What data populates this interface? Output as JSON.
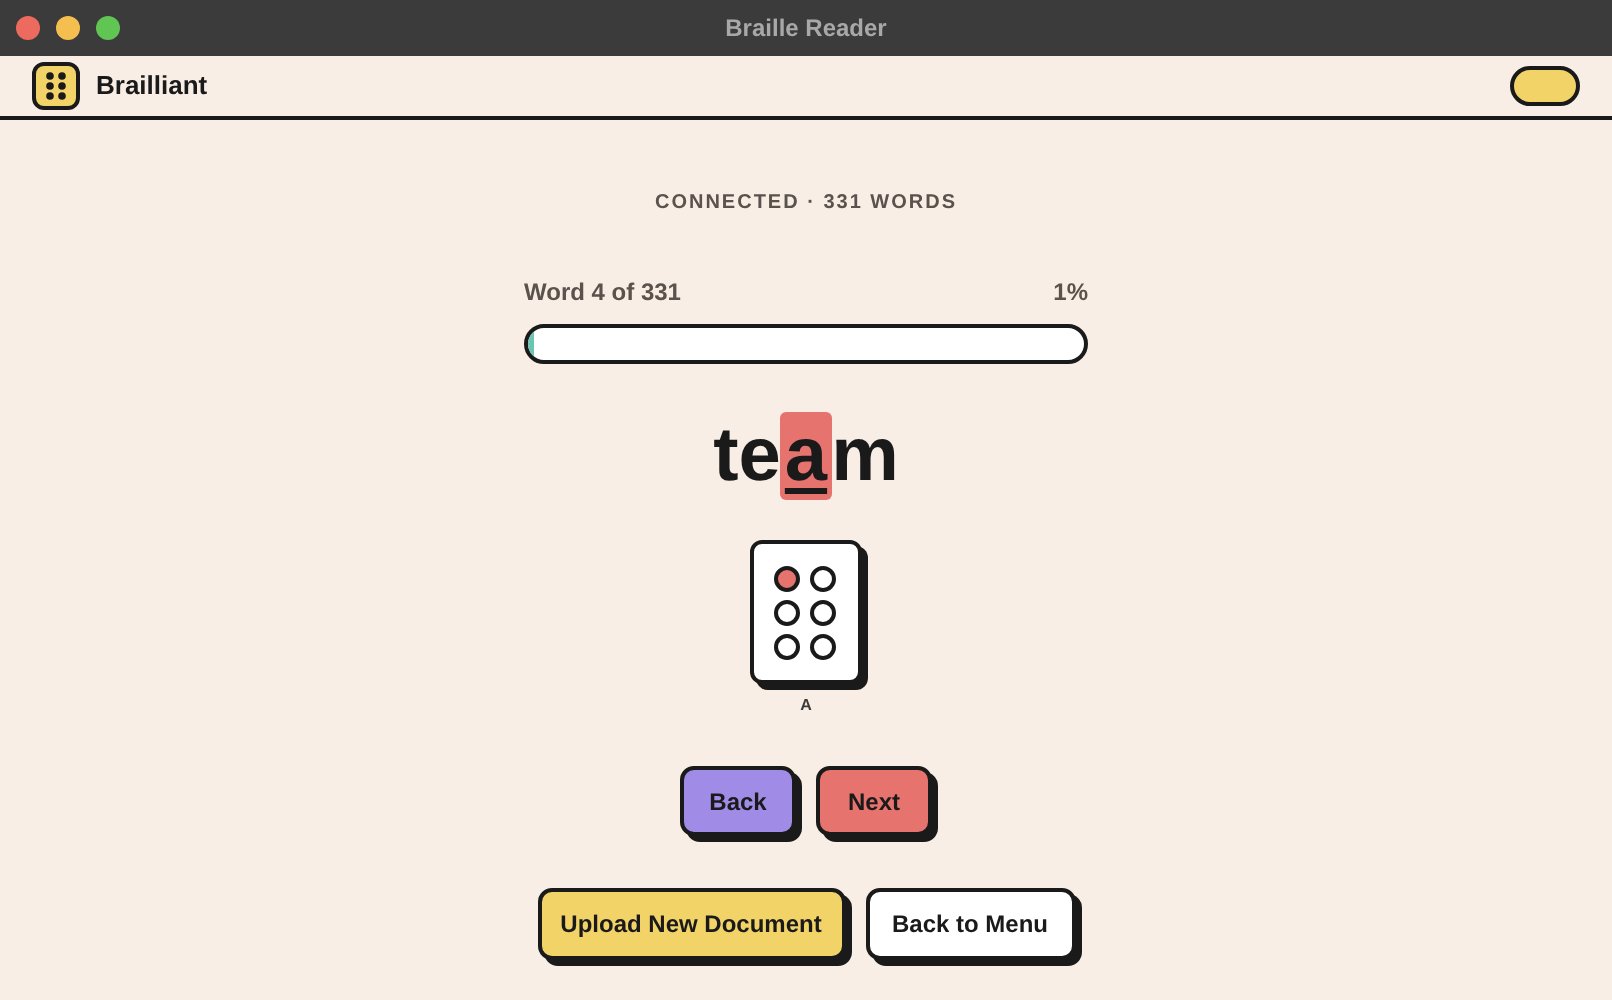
{
  "window": {
    "title": "Braille Reader"
  },
  "header": {
    "app_name": "Brailliant"
  },
  "status": "CONNECTED · 331 WORDS",
  "progress": {
    "label": "Word 4 of 331",
    "percent": "1%",
    "level": 0.01
  },
  "word": {
    "letters": [
      {
        "char": "t",
        "selected": false
      },
      {
        "char": "e",
        "selected": false
      },
      {
        "char": "a",
        "selected": true
      },
      {
        "char": "m",
        "selected": false
      }
    ]
  },
  "braille_cell": {
    "dots": [
      {
        "raised": true
      },
      {
        "raised": false
      },
      {
        "raised": false
      },
      {
        "raised": false
      },
      {
        "raised": false
      },
      {
        "raised": false
      }
    ],
    "caption": "A"
  },
  "nav_buttons": [
    {
      "label": "Back",
      "color": "#a08ce6"
    },
    {
      "label": "Next",
      "color": "#e6736e"
    }
  ],
  "action_buttons": [
    {
      "label": "Upload New Document",
      "color": "#f2d368"
    },
    {
      "label": "Back to Menu",
      "color": "#ffffff"
    }
  ]
}
